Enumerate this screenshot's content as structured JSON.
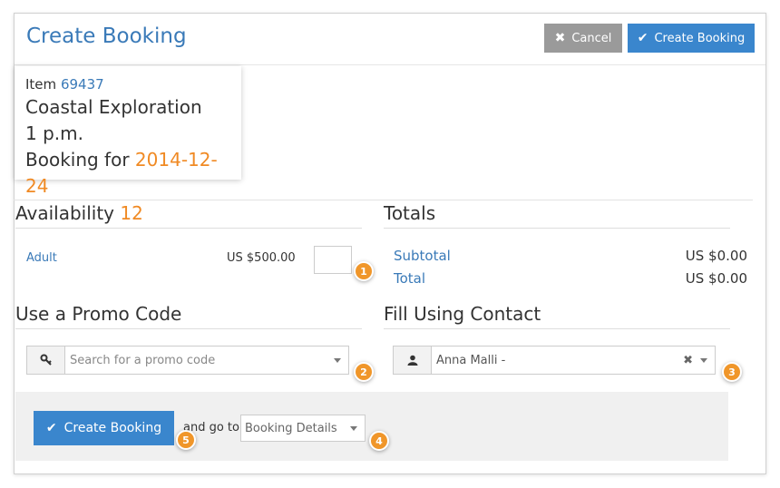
{
  "header": {
    "title": "Create Booking",
    "cancel_label": "Cancel",
    "create_label": "Create Booking"
  },
  "item": {
    "prefix": "Item",
    "id": "69437",
    "name": "Coastal Exploration",
    "time": "1 p.m.",
    "booking_for_label": "Booking for",
    "date": "2014-12-24"
  },
  "availability": {
    "title": "Availability",
    "count": "12",
    "rows": [
      {
        "label": "Adult",
        "price": "US $500.00",
        "quantity": ""
      }
    ]
  },
  "totals": {
    "title": "Totals",
    "subtotal_label": "Subtotal",
    "subtotal_value": "US $0.00",
    "total_label": "Total",
    "total_value": "US $0.00"
  },
  "promo": {
    "title": "Use a Promo Code",
    "placeholder": "Search for a promo code",
    "icon": "key-icon"
  },
  "contact": {
    "title": "Fill Using Contact",
    "value": "Anna Malli -",
    "icon": "user-icon"
  },
  "footer": {
    "create_label": "Create Booking",
    "and_go_to": "and go to",
    "destination": "Booking Details"
  },
  "badges": [
    "1",
    "2",
    "3",
    "4",
    "5"
  ],
  "colors": {
    "primary": "#3a86cd",
    "title_blue": "#3a7ab8",
    "accent_orange": "#f08a24",
    "cancel_gray": "#9a9a9a",
    "badge_orange": "#f0962a"
  }
}
